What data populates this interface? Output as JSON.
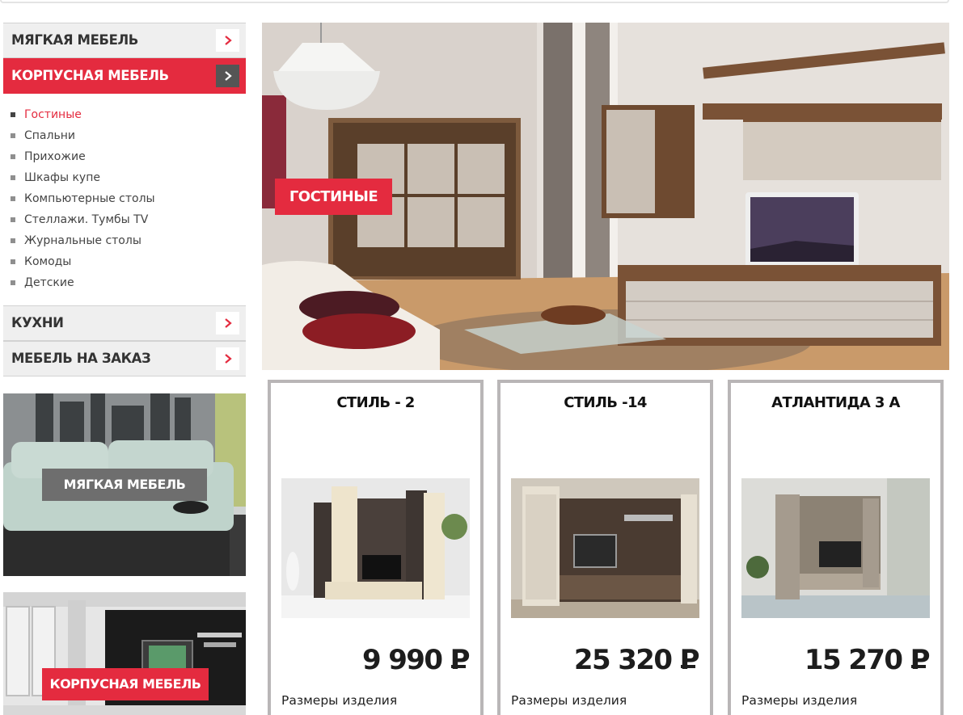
{
  "sidebar": {
    "categories": [
      {
        "label": "МЯГКАЯ МЕБЕЛЬ"
      },
      {
        "label": "КОРПУСНАЯ МЕБЕЛЬ"
      },
      {
        "label": "КУХНИ"
      },
      {
        "label": "МЕБЕЛЬ НА ЗАКАЗ"
      }
    ],
    "subitems": [
      {
        "label": "Гостиные"
      },
      {
        "label": "Спальни"
      },
      {
        "label": "Прихожие"
      },
      {
        "label": "Шкафы купе"
      },
      {
        "label": "Компьютерные столы"
      },
      {
        "label": "Стеллажи. Тумбы TV"
      },
      {
        "label": "Журнальные столы"
      },
      {
        "label": "Комоды"
      },
      {
        "label": "Детские"
      }
    ],
    "promos": [
      {
        "label": "МЯГКАЯ МЕБЕЛЬ"
      },
      {
        "label": "КОРПУСНАЯ МЕБЕЛЬ"
      }
    ]
  },
  "hero": {
    "label": "ГОСТИНЫЕ"
  },
  "products": [
    {
      "title": "СТИЛЬ - 2",
      "price": "9 990",
      "currency": "Р",
      "sizes_label": "Размеры изделия"
    },
    {
      "title": "СТИЛЬ -14",
      "price": "25 320",
      "currency": "Р",
      "sizes_label": "Размеры изделия"
    },
    {
      "title": "АТЛАНТИДА 3 А",
      "price": "15 270",
      "currency": "Р",
      "sizes_label": "Размеры изделия"
    }
  ],
  "colors": {
    "accent": "#e42b3f",
    "dark_arrow": "#555555",
    "card_border": "#b9b6b7",
    "menu_bg": "#efefef"
  },
  "icons": {
    "category_arrow": "chevron-right-icon",
    "list_marker": "square-bullet-icon"
  }
}
